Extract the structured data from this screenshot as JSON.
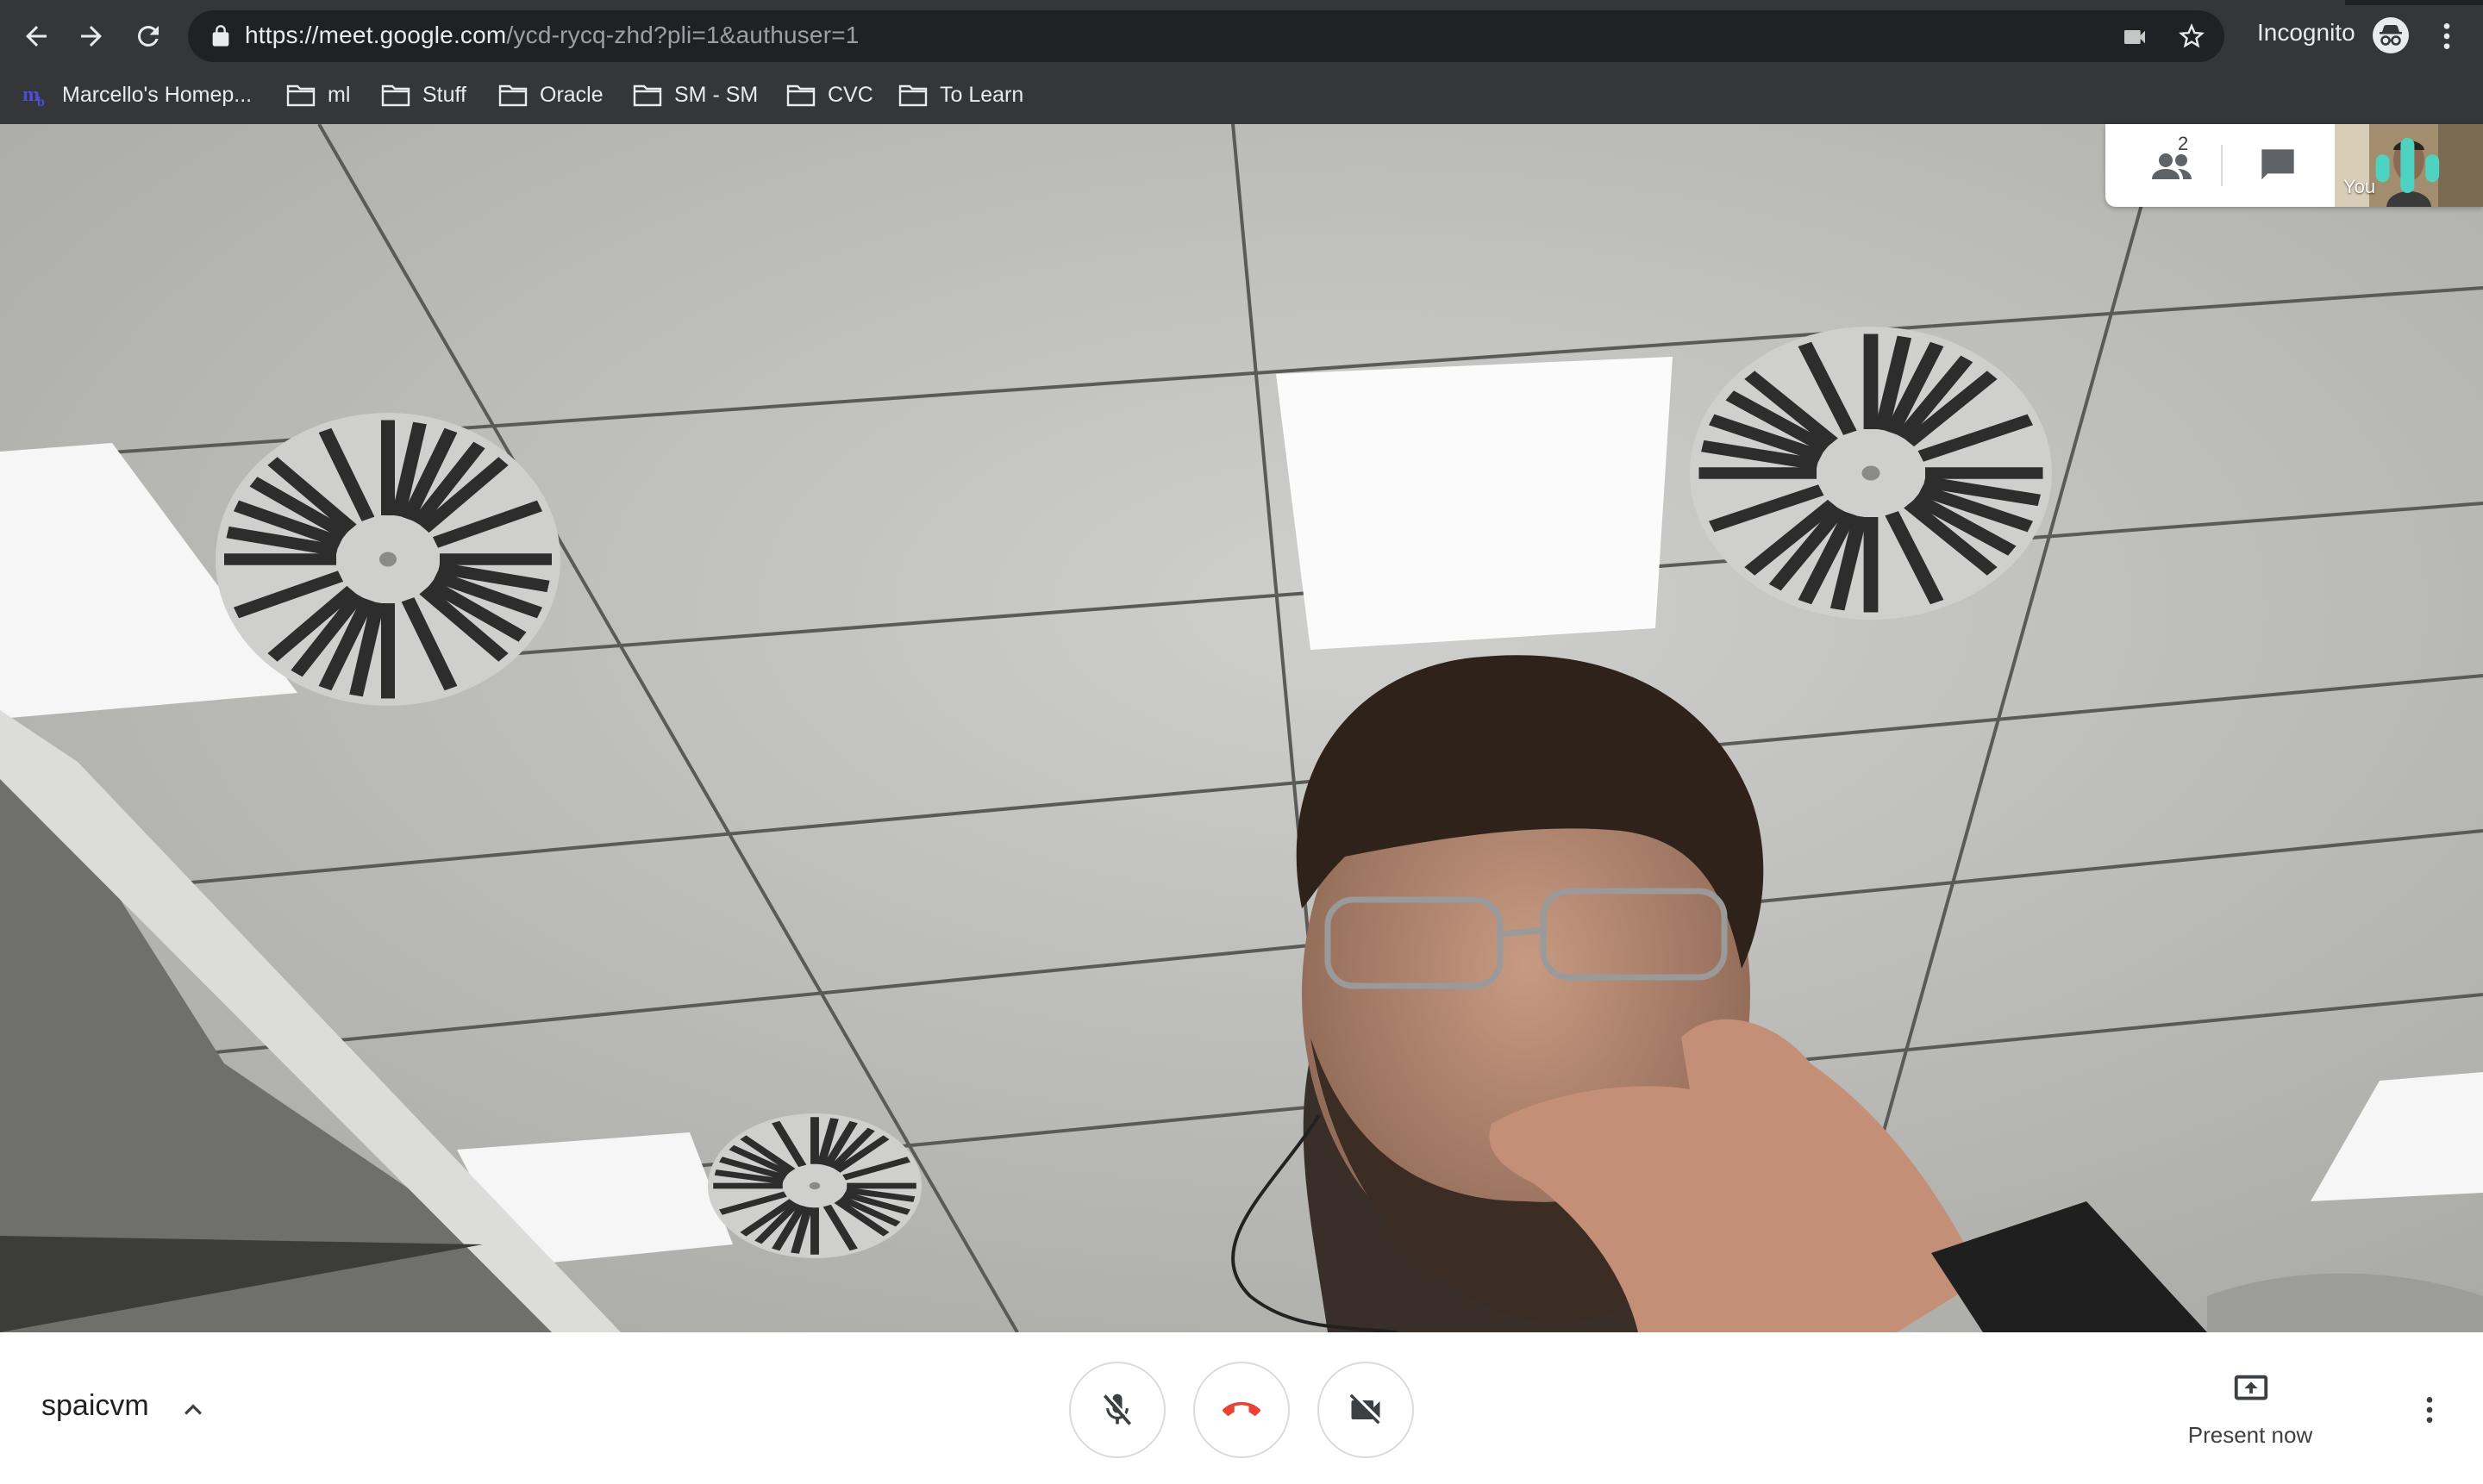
{
  "browser": {
    "url_main": "https://meet.google.com",
    "url_rest": "/ycd-rycq-zhd?pli=1&authuser=1",
    "incognito_label": "Incognito",
    "icons": {
      "back": "arrow-left-icon",
      "forward": "arrow-right-icon",
      "reload": "reload-icon",
      "lock": "lock-icon",
      "camera": "camera-icon",
      "bookmark_star": "star-icon",
      "menu": "kebab-menu-icon"
    },
    "bookmarks": [
      {
        "label": "Marcello's Homep...",
        "icon": "site-favicon"
      },
      {
        "label": "ml",
        "icon": "folder-icon"
      },
      {
        "label": "Stuff",
        "icon": "folder-icon"
      },
      {
        "label": "Oracle",
        "icon": "folder-icon"
      },
      {
        "label": "SM - SM",
        "icon": "folder-icon"
      },
      {
        "label": "CVC",
        "icon": "folder-icon"
      },
      {
        "label": "To Learn",
        "icon": "folder-icon"
      }
    ]
  },
  "meet": {
    "participants_count": "2",
    "self_label": "You",
    "meeting_code": "spaicvm",
    "present_label": "Present now",
    "colors": {
      "hangup_red": "#ea4335",
      "audio_indicator": "#4ed2c1",
      "icon_gray": "#5f6368"
    }
  }
}
